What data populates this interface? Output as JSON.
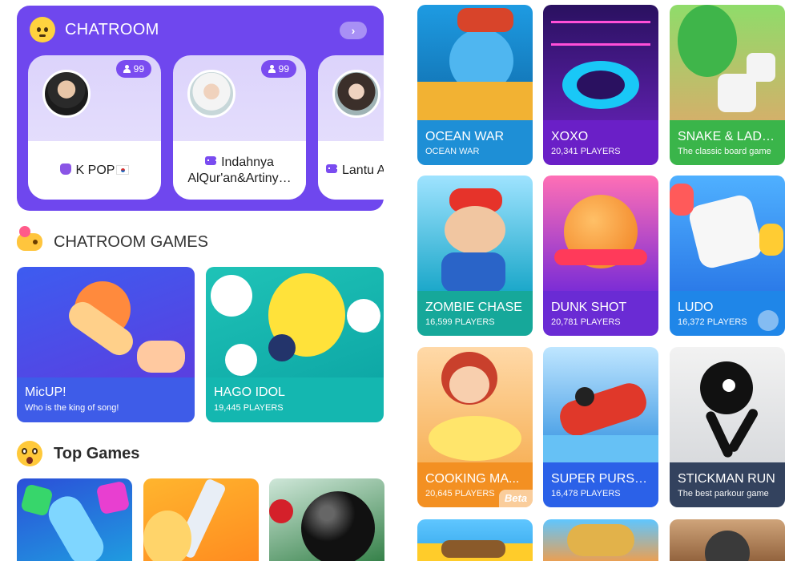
{
  "chatroom": {
    "title": "CHATROOM",
    "more_icon": "chevron-right-icon",
    "more_label": "›",
    "rooms": [
      {
        "count": "99",
        "label": "K POP",
        "icon": "hand-icon",
        "flag": "south-korea-flag"
      },
      {
        "count": "99",
        "label": "Indahnya AlQur'an&Artiny…",
        "icon": "chat-icon"
      },
      {
        "count": "",
        "label": "Lantu Ayat Suci",
        "icon": "chat-icon"
      }
    ]
  },
  "chatroom_games": {
    "title": "CHATROOM GAMES",
    "icon": "gamepad-icon",
    "cards": [
      {
        "title": "MicUP!",
        "subtitle": "Who is the king of song!",
        "color": "#3e5ce8"
      },
      {
        "title": "HAGO IDOL",
        "subtitle": "19,445 PLAYERS",
        "color": "#14b7b0"
      }
    ]
  },
  "top_games": {
    "title": "Top Games",
    "icon": "surprised-face-icon"
  },
  "games": [
    {
      "title": "OCEAN WAR",
      "subtitle": "OCEAN WAR",
      "color": "#1e8fd6"
    },
    {
      "title": "XOXO",
      "subtitle": "20,341 PLAYERS",
      "color": "#6a1fc7"
    },
    {
      "title": "SNAKE & LADD...",
      "subtitle": "The classic board game",
      "color": "#3ab54a"
    },
    {
      "title": "ZOMBIE CHASE",
      "subtitle": "16,599 PLAYERS",
      "color": "#16a89a"
    },
    {
      "title": "DUNK SHOT",
      "subtitle": "20,781 PLAYERS",
      "color": "#6a2bd4"
    },
    {
      "title": "LUDO",
      "subtitle": "16,372 PLAYERS",
      "color": "#1f86e8"
    },
    {
      "title": "COOKING MA...",
      "subtitle": "20,645 PLAYERS",
      "color": "#f39022",
      "badge": "Beta"
    },
    {
      "title": "SUPER PURSUIT",
      "subtitle": "16,478 PLAYERS",
      "color": "#2b61e8"
    },
    {
      "title": "STICKMAN RUN",
      "subtitle": "The best parkour game",
      "color": "#33425e"
    }
  ]
}
